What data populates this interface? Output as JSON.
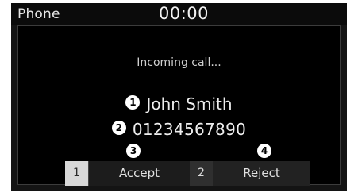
{
  "header": {
    "app_title": "Phone",
    "clock": "00:00"
  },
  "call": {
    "status": "Incoming call...",
    "caller_name": "John Smith",
    "caller_number": "01234567890"
  },
  "callouts": {
    "name": "1",
    "number": "2",
    "accept": "3",
    "reject": "4"
  },
  "buttons": {
    "accept": {
      "index": "1",
      "label": "Accept"
    },
    "reject": {
      "index": "2",
      "label": "Reject"
    }
  },
  "colors": {
    "screen_bg": "#141414",
    "panel_bg": "#000000",
    "text": "#eeeeee",
    "callout_bg": "#ffffff"
  }
}
